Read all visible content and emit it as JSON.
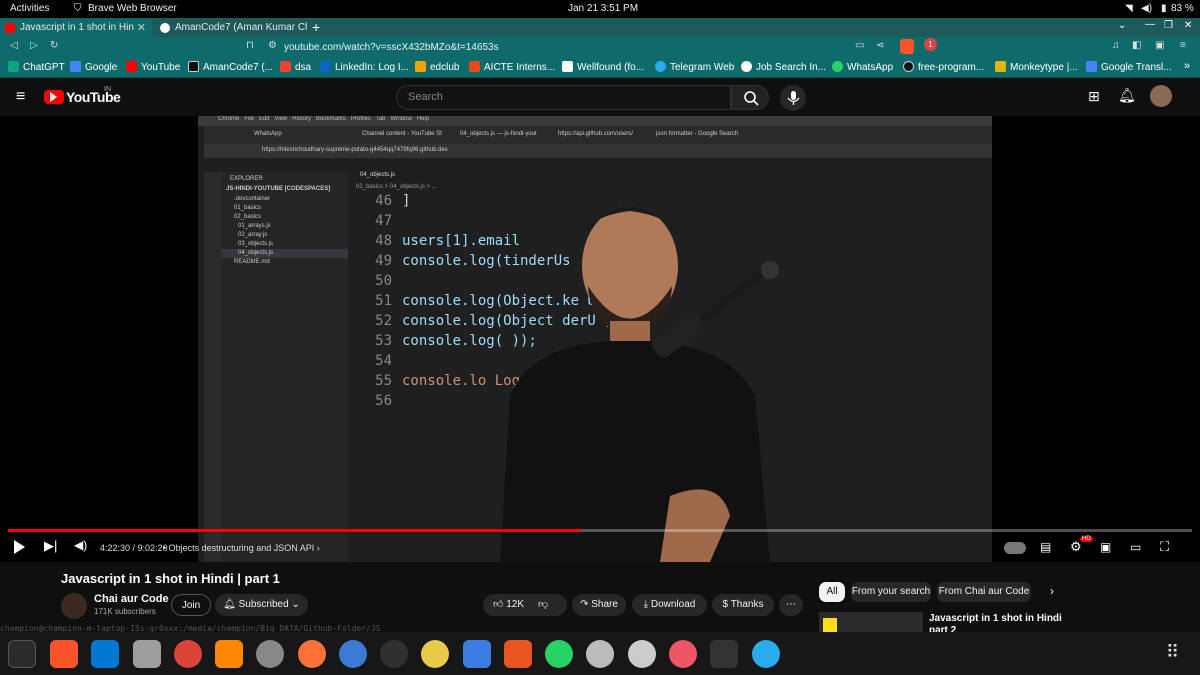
{
  "system": {
    "activities": "Activities",
    "app_name": "Brave Web Browser",
    "datetime": "Jan 21  3:51 PM",
    "battery": "83 %"
  },
  "browser": {
    "tabs": [
      {
        "label": "Javascript in 1 shot in Hin",
        "favicon": "youtube-icon",
        "active": true
      },
      {
        "label": "AmanCode7 (Aman Kumar Ch",
        "favicon": "github-icon",
        "active": false
      }
    ],
    "url": "youtube.com/watch?v=sscX432bMZo&t=14653s",
    "shields_count": "1",
    "bookmarks": [
      {
        "label": "ChatGPT",
        "icon": "chatgpt-icon",
        "color": "#10a37f"
      },
      {
        "label": "Google",
        "icon": "google-icon",
        "color": "#4285f4"
      },
      {
        "label": "YouTube",
        "icon": "youtube-icon",
        "color": "#ff0000"
      },
      {
        "label": "AmanCode7 (...",
        "icon": "github-icon",
        "color": "#111111"
      },
      {
        "label": "dsa",
        "icon": "gmail-icon",
        "color": "#ea4335"
      },
      {
        "label": "LinkedIn: Log I...",
        "icon": "linkedin-icon",
        "color": "#0a66c2"
      },
      {
        "label": "edclub",
        "icon": "edclub-icon",
        "color": "#f4a300"
      },
      {
        "label": "AICTE Interns...",
        "icon": "aicte-icon",
        "color": "#e64a19"
      },
      {
        "label": "Wellfound (fo...",
        "icon": "wellfound-icon",
        "color": "#ffffff"
      },
      {
        "label": "Telegram Web",
        "icon": "telegram-icon",
        "color": "#2aabee"
      },
      {
        "label": "Job Search In...",
        "icon": "info-icon",
        "color": "#ffffff"
      },
      {
        "label": "WhatsApp",
        "icon": "whatsapp-icon",
        "color": "#25d366"
      },
      {
        "label": "free-program...",
        "icon": "github-icon",
        "color": "#111111"
      },
      {
        "label": "Monkeytype |...",
        "icon": "monkeytype-icon",
        "color": "#e2b714"
      },
      {
        "label": "Google Transl...",
        "icon": "translate-icon",
        "color": "#4285f4"
      }
    ]
  },
  "youtube": {
    "logo_text": "YouTube",
    "logo_region": "IN",
    "search_placeholder": "Search"
  },
  "video": {
    "code_lines": [
      {
        "n": "46",
        "text": "]"
      },
      {
        "n": "47",
        "text": ""
      },
      {
        "n": "48",
        "text": "users[1].email"
      },
      {
        "n": "49",
        "text": "console.log(tinderUs"
      },
      {
        "n": "50",
        "text": ""
      },
      {
        "n": "51",
        "text": "console.log(Object.ke          User));"
      },
      {
        "n": "52",
        "text": "console.log(Object          derU    );"
      },
      {
        "n": "53",
        "text": "console.log(                      ));"
      },
      {
        "n": "54",
        "text": ""
      },
      {
        "n": "55",
        "text": "console.lo                  LoggedIn'));"
      },
      {
        "n": "56",
        "text": ""
      }
    ],
    "inner_tabs": [
      "WhatsApp",
      "Channel content - YouTube St",
      "04_objects.js — js-hindi-yout",
      "https://api.github.com/users/",
      "json formatter - Google Search"
    ],
    "inner_url": "https://hiteshchoudhary-supreme-potato-g4454qq7479fq96.github.dev",
    "explorer": {
      "title": "EXPLORER",
      "root": "JS-HINDI-YOUTUBE [CODESPACES]",
      "items": [
        ".devcontainer",
        "01_basics",
        "02_basics",
        "01_arrays.js",
        "02_array.js",
        "03_objects.js",
        "04_objects.js",
        "README.md"
      ]
    },
    "editor_tab": "04_objects.js",
    "breadcrumb": "02_basics > 04_objects.js > ...",
    "time_current": "4:22:30",
    "time_total": "9:02:20",
    "chapter": "Objects destructuring and JSON API",
    "progress": 0.484
  },
  "meta": {
    "title": "Javascript in 1 shot in Hindi | part 1",
    "channel": "Chai aur Code",
    "subscribers": "171K subscribers",
    "join_label": "Join",
    "subscribed_label": "Subscribed",
    "likes": "12K",
    "share_label": "Share",
    "download_label": "Download",
    "thanks_label": "Thanks",
    "chips": [
      "All",
      "From your search",
      "From Chai aur Code"
    ],
    "next_video_title": "Javascript in 1 shot in Hindi",
    "next_video_sub": "part 2",
    "terminal_line": "champion@champion-m-laptop-15s-gr0xxx:/media/champion/Big DATA/Github-Folder/JS"
  },
  "colors": {
    "accent": "#ff0000",
    "browser_teal": "#0f6b6b"
  }
}
